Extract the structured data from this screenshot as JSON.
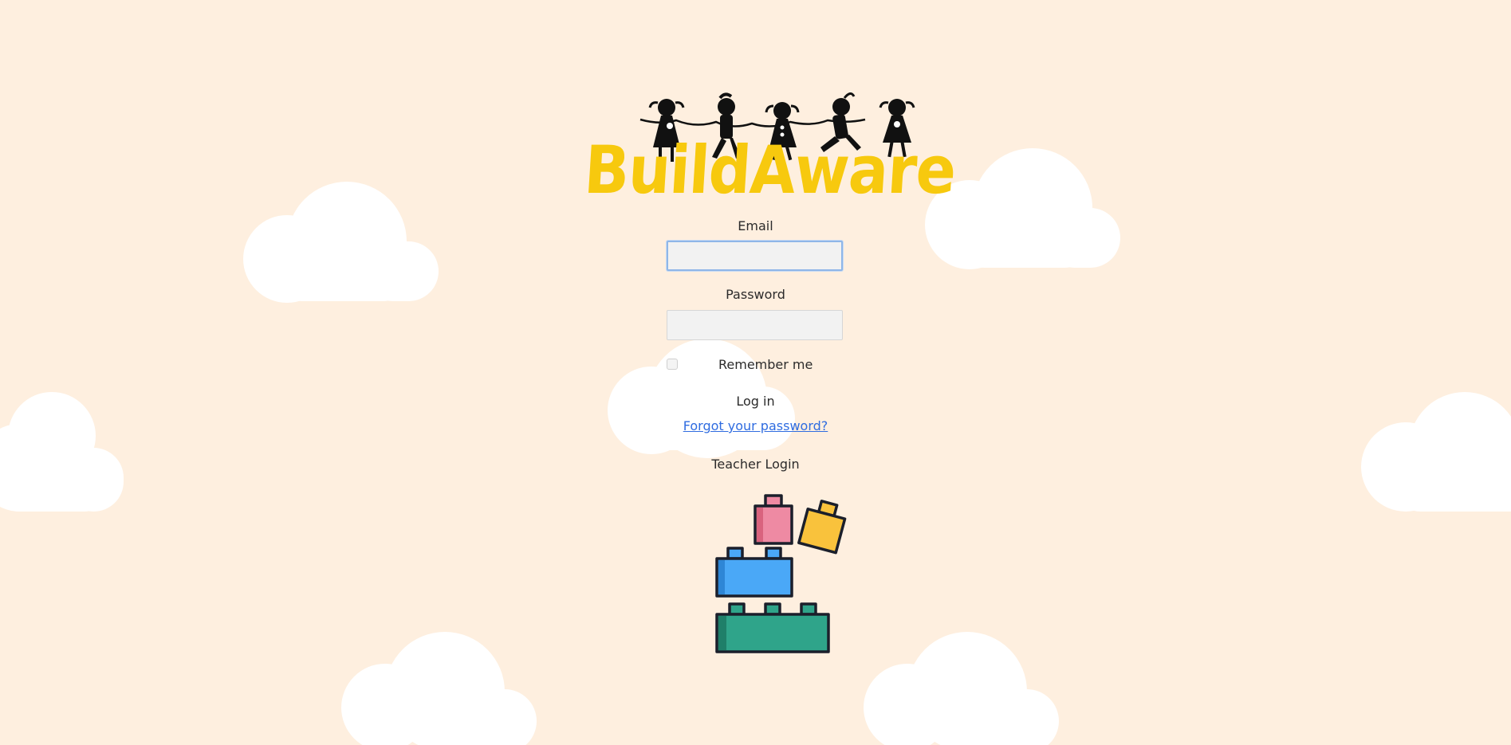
{
  "app": {
    "logo_text": "BuildAware"
  },
  "form": {
    "email_label": "Email",
    "email_value": "",
    "password_label": "Password",
    "password_value": "",
    "remember_label": "Remember me",
    "remember_checked": false,
    "login_label": "Log in",
    "forgot_label": "Forgot your password?",
    "teacher_login_label": "Teacher Login"
  },
  "colors": {
    "background": "#FEEFDF",
    "logo_yellow": "#F7C90E",
    "link_blue": "#2F6CE0",
    "block_pink": "#EE8AA3",
    "block_yellow": "#F9C23C",
    "block_blue": "#4AA8F7",
    "block_green": "#2FA48A"
  },
  "icons": {
    "logo_figures": "dancing-children-silhouettes",
    "illustration": "stacked-building-blocks"
  }
}
